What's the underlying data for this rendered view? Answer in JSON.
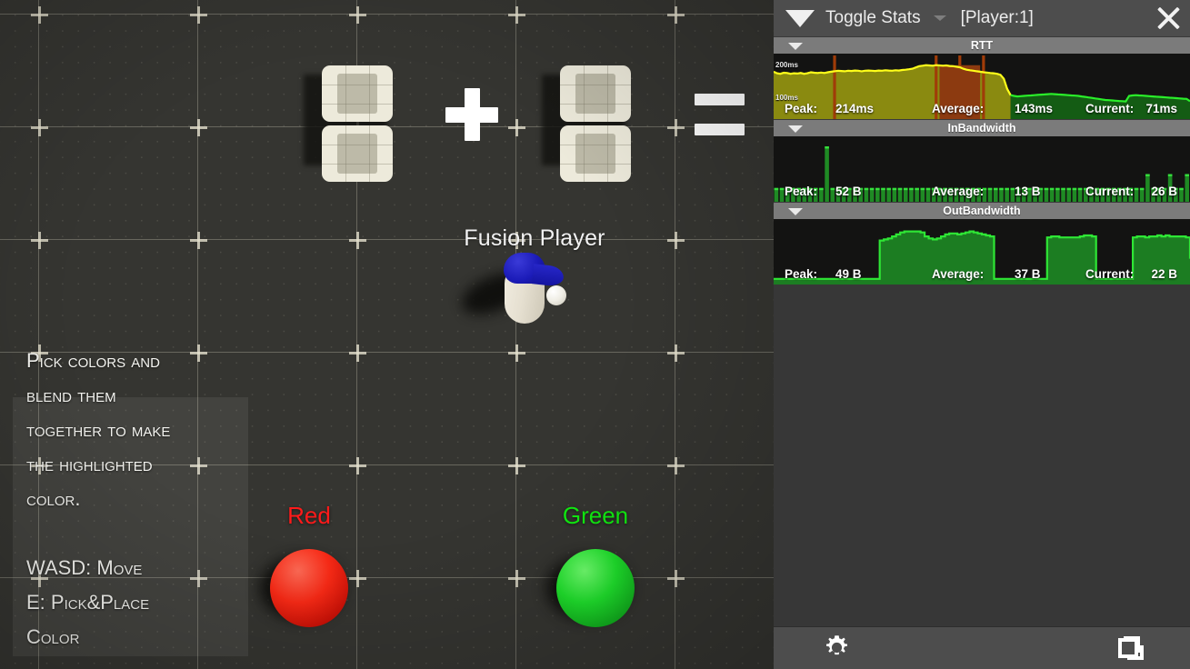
{
  "game": {
    "player_label": "Fusion Player",
    "instructions": "Pick colors and\nblend them\ntogether to make\nthe highlighted\ncolor.\n\nWASD: Move\nE: Pick&Place\nColor",
    "operator_plus": "+",
    "operator_equals": "=",
    "target_slots": [
      {
        "name": "target-color-slot-a",
        "color": "#edeadb"
      },
      {
        "name": "target-color-slot-b",
        "color": "#edeadb"
      }
    ],
    "pickups": [
      {
        "label": "Red",
        "color": "#ff2a18",
        "label_color": "#ff1a1a"
      },
      {
        "label": "Green",
        "color": "#1ed627",
        "label_color": "#11ee11"
      }
    ],
    "background_color": "#353531",
    "grid_line_color": "#deda c8"
  },
  "stats": {
    "header": {
      "toggle_label": "Toggle Stats",
      "player_label": "[Player:1]",
      "close_label": "×",
      "collapse_icon": "triangle-down-icon",
      "dropdown_icon": "chevron-down-icon"
    },
    "sections": [
      {
        "id": "rtt",
        "title": "RTT",
        "axis_labels": [
          "200ms",
          "100ms"
        ],
        "peak_label": "Peak:",
        "peak_value": "214ms",
        "average_label": "Average:",
        "average_value": "143ms",
        "current_label": "Current:",
        "current_value": "71ms"
      },
      {
        "id": "inbandwidth",
        "title": "InBandwidth",
        "axis_labels": [],
        "peak_label": "Peak:",
        "peak_value": "52 B",
        "average_label": "Average:",
        "average_value": "13 B",
        "current_label": "Current:",
        "current_value": "26 B"
      },
      {
        "id": "outbandwidth",
        "title": "OutBandwidth",
        "axis_labels": [],
        "peak_label": "Peak:",
        "peak_value": "49 B",
        "average_label": "Average:",
        "average_value": "37 B",
        "current_label": "Current:",
        "current_value": "22 B"
      }
    ],
    "toolbar": {
      "settings_icon": "gear-icon",
      "windows_icon": "copy-windows-icon"
    }
  },
  "chart_data": [
    {
      "type": "area",
      "id": "rtt-graph",
      "title": "RTT",
      "ylabel": "ms",
      "ylim": [
        0,
        260
      ],
      "yticks": [
        100,
        200
      ],
      "ytick_labels": [
        "100ms",
        "200ms"
      ],
      "grid": false,
      "legend": "none",
      "series": [
        {
          "name": "RTT",
          "values": [
            188,
            182,
            180,
            184,
            183,
            180,
            182,
            181,
            183,
            180,
            182,
            186,
            184,
            183,
            185,
            183,
            186,
            188,
            190,
            192,
            191,
            190,
            192,
            191,
            193,
            192,
            190,
            192,
            193,
            192,
            191,
            193,
            192,
            194,
            193,
            192,
            194,
            193,
            195,
            196,
            198,
            200,
            205,
            210,
            212,
            214,
            213,
            212,
            214,
            213,
            212,
            213,
            211,
            210,
            208,
            206,
            200,
            196,
            194,
            192,
            190,
            188,
            186,
            185,
            183,
            182,
            180,
            176,
            160,
            120,
            95,
            92,
            90,
            91,
            92,
            93,
            94,
            95,
            96,
            97,
            98,
            99,
            100,
            99,
            98,
            97,
            96,
            95,
            94,
            93,
            92,
            90,
            88,
            86,
            84,
            82,
            80,
            78,
            76,
            75,
            74,
            73,
            72,
            71,
            70,
            92,
            94,
            95,
            94,
            93,
            92,
            91,
            90,
            89,
            88,
            87,
            86,
            85,
            84,
            83,
            82,
            81,
            80,
            71
          ],
          "color": "#ffff00"
        }
      ],
      "peak": 214,
      "average": 143,
      "current": 71,
      "notes": "Yellow/olive fill for the high-latency history, green fill for the recent low-latency portion; dark orange spikes mark stalls."
    },
    {
      "type": "bar",
      "id": "inbandwidth-graph",
      "title": "InBandwidth",
      "ylabel": "bytes",
      "ylim": [
        0,
        58
      ],
      "grid": false,
      "legend": "none",
      "categories": [],
      "values": [
        13,
        13,
        13,
        13,
        13,
        13,
        13,
        13,
        13,
        52,
        13,
        13,
        13,
        13,
        13,
        13,
        13,
        13,
        13,
        13,
        13,
        13,
        13,
        13,
        13,
        13,
        13,
        13,
        13,
        13,
        13,
        13,
        13,
        13,
        13,
        13,
        13,
        13,
        13,
        13,
        13,
        13,
        13,
        13,
        13,
        13,
        13,
        13,
        13,
        13,
        13,
        13,
        13,
        13,
        13,
        13,
        13,
        13,
        13,
        13,
        13,
        13,
        13,
        13,
        13,
        13,
        26,
        13,
        13,
        13,
        26,
        13,
        13,
        26
      ],
      "color": "#22cc33",
      "peak": 52,
      "average": 13,
      "current": 26
    },
    {
      "type": "area",
      "id": "outbandwidth-graph",
      "title": "OutBandwidth",
      "ylabel": "bytes",
      "ylim": [
        0,
        54
      ],
      "grid": false,
      "legend": "none",
      "values": [
        2,
        2,
        2,
        2,
        2,
        2,
        2,
        2,
        2,
        2,
        2,
        2,
        2,
        2,
        2,
        2,
        2,
        2,
        2,
        2,
        2,
        2,
        2,
        2,
        2,
        2,
        40,
        41,
        42,
        44,
        46,
        48,
        49,
        49,
        49,
        49,
        48,
        44,
        42,
        41,
        42,
        44,
        46,
        47,
        47,
        46,
        47,
        48,
        49,
        48,
        47,
        46,
        45,
        44,
        2,
        2,
        2,
        2,
        2,
        2,
        2,
        2,
        2,
        2,
        2,
        2,
        2,
        43,
        44,
        44,
        43,
        43,
        43,
        43,
        43,
        44,
        45,
        45,
        44,
        2,
        2,
        2,
        2,
        2,
        2,
        2,
        2,
        2,
        43,
        44,
        44,
        43,
        44,
        44,
        45,
        44,
        45,
        44,
        44,
        44,
        44,
        43,
        22
      ],
      "color": "#22cc33",
      "peak": 49,
      "average": 37,
      "current": 22
    }
  ]
}
